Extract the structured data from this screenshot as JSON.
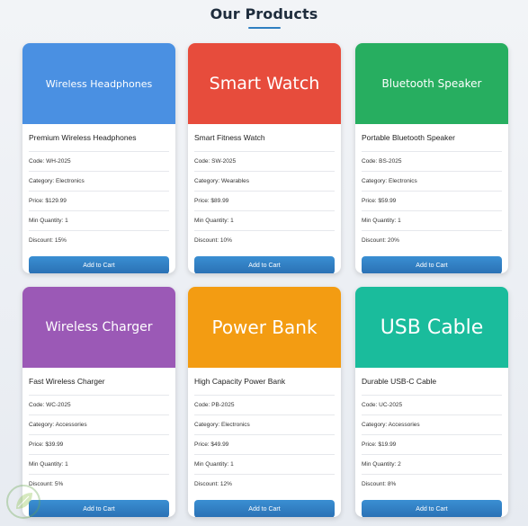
{
  "page": {
    "title": "Our Products"
  },
  "labels": {
    "code": "Code:",
    "category": "Category:",
    "price": "Price:",
    "min_quantity": "Min Quantity:",
    "discount": "Discount:",
    "add_to_cart": "Add to Cart"
  },
  "products": [
    {
      "banner": "Wireless Headphones",
      "banner_color": "#4a90e2",
      "name": "Premium Wireless Headphones",
      "code": "Code: WH-2025",
      "category": "Category: Electronics",
      "price": "Price: $129.99",
      "min_quantity": "Min Quantity: 1",
      "discount": "Discount: 15%",
      "button": "Add to Cart"
    },
    {
      "banner": "Smart Watch",
      "banner_color": "#e74c3c",
      "name": "Smart Fitness Watch",
      "code": "Code: SW-2025",
      "category": "Category: Wearables",
      "price": "Price: $89.99",
      "min_quantity": "Min Quantity: 1",
      "discount": "Discount: 10%",
      "button": "Add to Cart"
    },
    {
      "banner": "Bluetooth Speaker",
      "banner_color": "#27ae60",
      "name": "Portable Bluetooth Speaker",
      "code": "Code: BS-2025",
      "category": "Category: Electronics",
      "price": "Price: $59.99",
      "min_quantity": "Min Quantity: 1",
      "discount": "Discount: 20%",
      "button": "Add to Cart"
    },
    {
      "banner": "Wireless Charger",
      "banner_color": "#9b59b6",
      "name": "Fast Wireless Charger",
      "code": "Code: WC-2025",
      "category": "Category: Accessories",
      "price": "Price: $39.99",
      "min_quantity": "Min Quantity: 1",
      "discount": "Discount: 5%",
      "button": "Add to Cart"
    },
    {
      "banner": "Power Bank",
      "banner_color": "#f39c12",
      "name": "High Capacity Power Bank",
      "code": "Code: PB-2025",
      "category": "Category: Electronics",
      "price": "Price: $49.99",
      "min_quantity": "Min Quantity: 1",
      "discount": "Discount: 12%",
      "button": "Add to Cart"
    },
    {
      "banner": "USB Cable",
      "banner_color": "#1abc9c",
      "name": "Durable USB-C Cable",
      "code": "Code: UC-2025",
      "category": "Category: Accessories",
      "price": "Price: $19.99",
      "min_quantity": "Min Quantity: 2",
      "discount": "Discount: 8%",
      "button": "Add to Cart"
    }
  ],
  "colors": {
    "button": "#2f80c6",
    "title_underline": "#2f7fc1"
  },
  "icons": {
    "watermark": "leaf-logo-icon"
  }
}
